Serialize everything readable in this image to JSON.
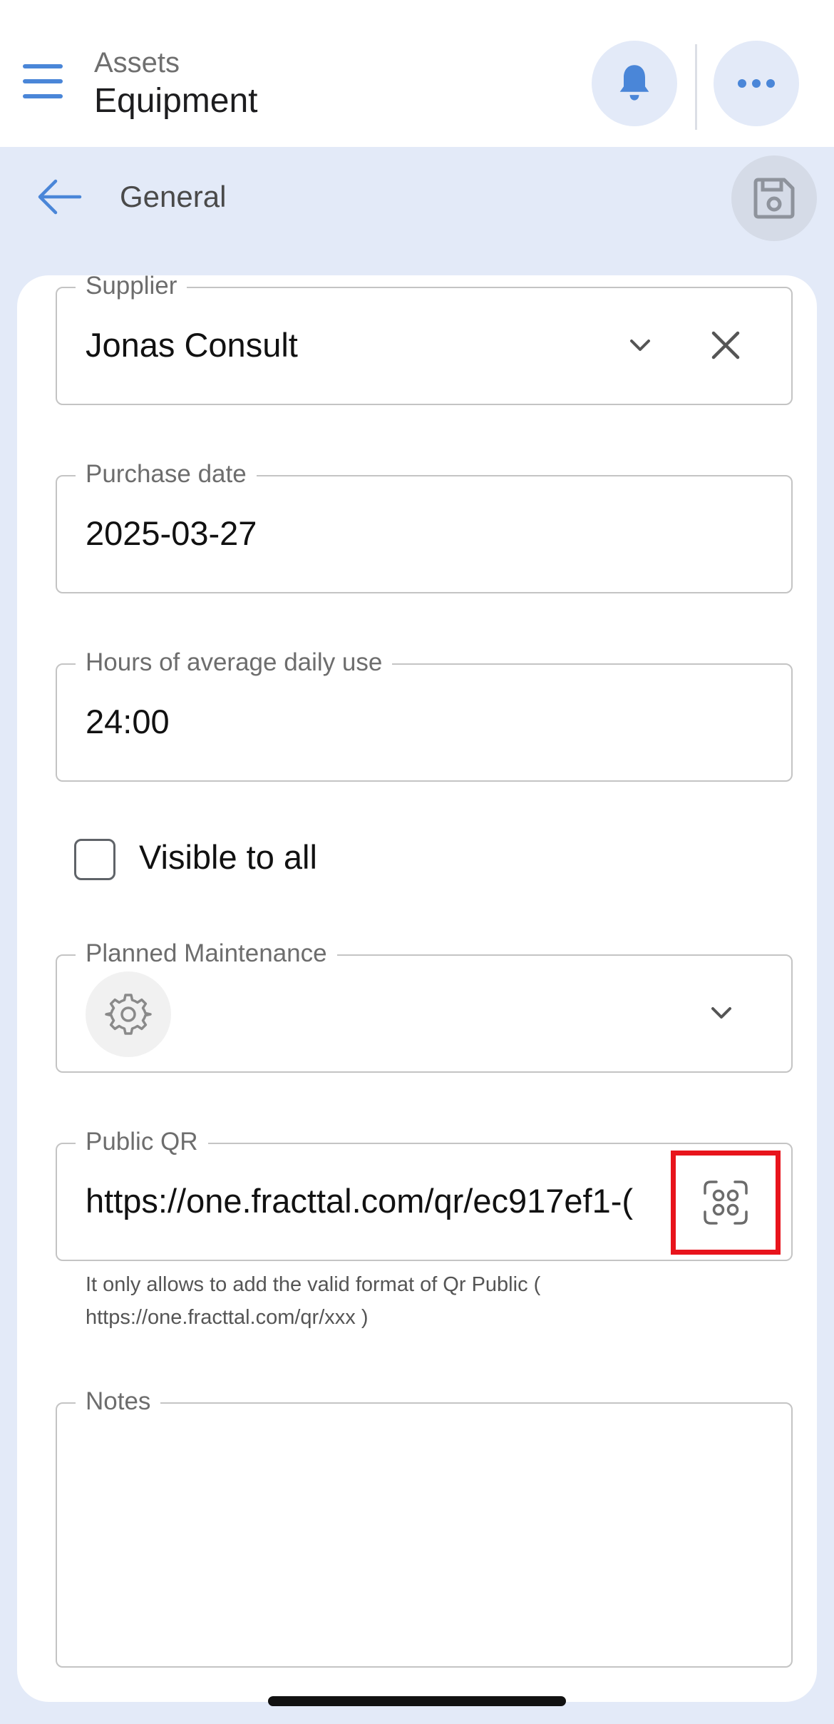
{
  "header": {
    "section": "Assets",
    "title": "Equipment",
    "bell_icon": "bell-icon",
    "more_icon": "more-horizontal-icon",
    "menu_icon": "hamburger-menu-icon",
    "accent_color": "#4a86d8"
  },
  "subheader": {
    "back_icon": "arrow-left-icon",
    "title": "General",
    "save_icon": "save-disk-icon"
  },
  "form": {
    "supplier": {
      "label": "Supplier",
      "value": "Jonas Consult"
    },
    "purchase_date": {
      "label": "Purchase date",
      "value": "2025-03-27"
    },
    "daily_use": {
      "label": "Hours of average daily use",
      "value": "24:00"
    },
    "visible_to_all": {
      "label": "Visible to all",
      "checked": false
    },
    "planned_maintenance": {
      "label": "Planned Maintenance"
    },
    "public_qr": {
      "label": "Public QR",
      "value": "https://one.fracttal.com/qr/ec917ef1-(",
      "helper_line1": "It only allows to add the valid format of Qr Public (",
      "helper_line2": "https://one.fracttal.com/qr/xxx )",
      "scan_icon": "qr-scan-icon",
      "highlight_color": "#e8141c"
    },
    "notes": {
      "label": "Notes",
      "value": ""
    }
  }
}
